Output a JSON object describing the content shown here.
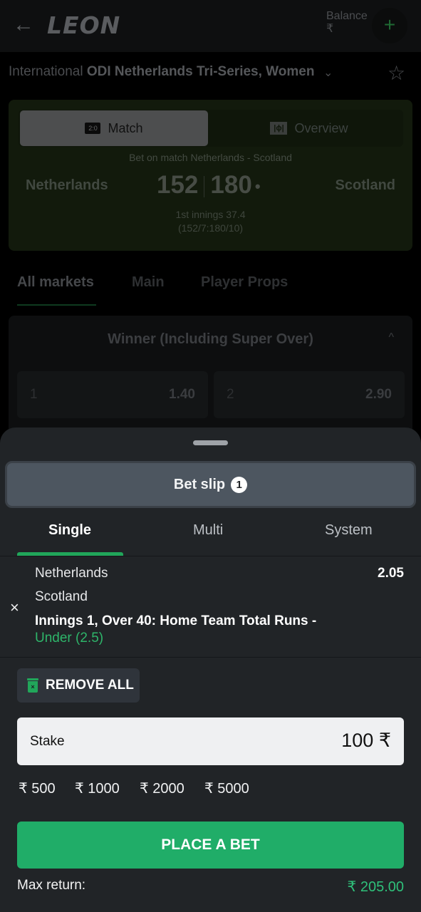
{
  "header": {
    "logo": "LEON",
    "balance_label": "Balance",
    "balance_currency": "₹",
    "back_icon": "←",
    "deposit_icon": "+"
  },
  "event": {
    "category": "International",
    "tournament": "ODI Netherlands Tri-Series, Women",
    "chevron": "⌄",
    "favorite_icon": "☆"
  },
  "match_card": {
    "tabs": [
      {
        "label": "Match",
        "icon_text": "2:0",
        "active": true
      },
      {
        "label": "Overview",
        "icon_text": "|ϕ|",
        "active": false
      }
    ],
    "bet_on_text": "Bet on match Netherlands - Scotland",
    "home_team": "Netherlands",
    "away_team": "Scotland",
    "home_score": "152",
    "away_score": "180",
    "serving_dot": "•",
    "innings_line1": "1st innings 37.4",
    "innings_line2": "(152/7:180/10)"
  },
  "market_tabs": [
    {
      "label": "All markets",
      "active": true
    },
    {
      "label": "Main",
      "active": false
    },
    {
      "label": "Player Props",
      "active": false
    }
  ],
  "market": {
    "title": "Winner (Including Super Over)",
    "caret": "^",
    "odds": [
      {
        "label": "1",
        "value": "1.40"
      },
      {
        "label": "2",
        "value": "2.90"
      }
    ]
  },
  "bet_slip": {
    "title": "Bet slip",
    "count": "1",
    "tabs": [
      {
        "label": "Single",
        "active": true
      },
      {
        "label": "Multi",
        "active": false
      },
      {
        "label": "System",
        "active": false
      }
    ],
    "item": {
      "home": "Netherlands",
      "away": "Scotland",
      "odds": "2.05",
      "market": "Innings 1, Over 40: Home Team Total Runs -",
      "selection": "Under (2.5)",
      "close_icon": "×"
    },
    "remove_all_label": "REMOVE ALL",
    "stake": {
      "label": "Stake",
      "value": "100 ₹"
    },
    "quick_stakes": [
      "₹ 500",
      "₹ 1000",
      "₹ 2000",
      "₹ 5000"
    ],
    "place_bet_label": "PLACE A BET",
    "max_return_label": "Max return:",
    "max_return_value": "₹ 205.00"
  },
  "colors": {
    "accent_green": "#20ad68",
    "selection_green": "#2eb56a",
    "sheet_bg": "#212427"
  }
}
